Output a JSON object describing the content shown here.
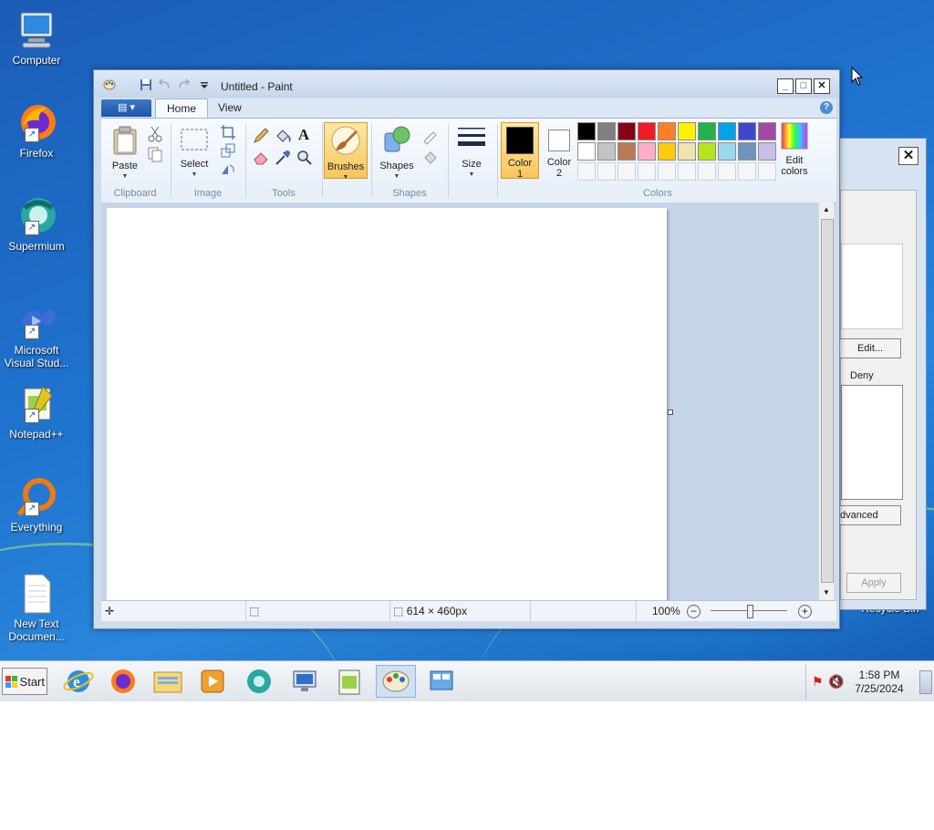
{
  "desktop": {
    "icons": [
      {
        "label": "Computer"
      },
      {
        "label": "Firefox"
      },
      {
        "label": "Supermium"
      },
      {
        "label": "Microsoft Visual Stud..."
      },
      {
        "label": "Notepad++"
      },
      {
        "label": "Everything"
      },
      {
        "label": "New Text Documen..."
      }
    ],
    "recycle_bin": "Recycle Bin"
  },
  "background_dialog": {
    "edit_button": "Edit...",
    "deny_label": "Deny",
    "advanced_button": "dvanced",
    "apply_button": "Apply",
    "close": "✕"
  },
  "paint": {
    "title": "Untitled - Paint",
    "app_menu_icon": "paint-menu-icon",
    "tabs": [
      "Home",
      "View"
    ],
    "groups": {
      "clipboard": {
        "label": "Clipboard",
        "paste": "Paste"
      },
      "image": {
        "label": "Image",
        "select": "Select"
      },
      "tools": {
        "label": "Tools"
      },
      "brushes": {
        "label": "Brushes"
      },
      "shapes": {
        "label": "Shapes",
        "shapes": "Shapes"
      },
      "size": {
        "label": "Size"
      },
      "colors": {
        "label": "Colors",
        "color1": "Color\n1",
        "color2": "Color\n2",
        "edit_colors": "Edit\ncolors",
        "color1_value": "#000000",
        "color2_value": "#ffffff",
        "palette_row1": [
          "#000000",
          "#7f7f7f",
          "#880015",
          "#ed1c24",
          "#ff7f27",
          "#fff200",
          "#22b14c",
          "#00a2e8",
          "#3f48cc",
          "#a349a4"
        ],
        "palette_row2": [
          "#ffffff",
          "#c3c3c3",
          "#b97a57",
          "#ffaec9",
          "#ffc90e",
          "#efe4b0",
          "#b5e61d",
          "#99d9ea",
          "#7092be",
          "#c8bfe7"
        ]
      }
    },
    "status": {
      "image_size": "614 × 460px",
      "zoom": "100%"
    }
  },
  "taskbar": {
    "start": "Start",
    "time": "1:58 PM",
    "date": "7/25/2024"
  }
}
